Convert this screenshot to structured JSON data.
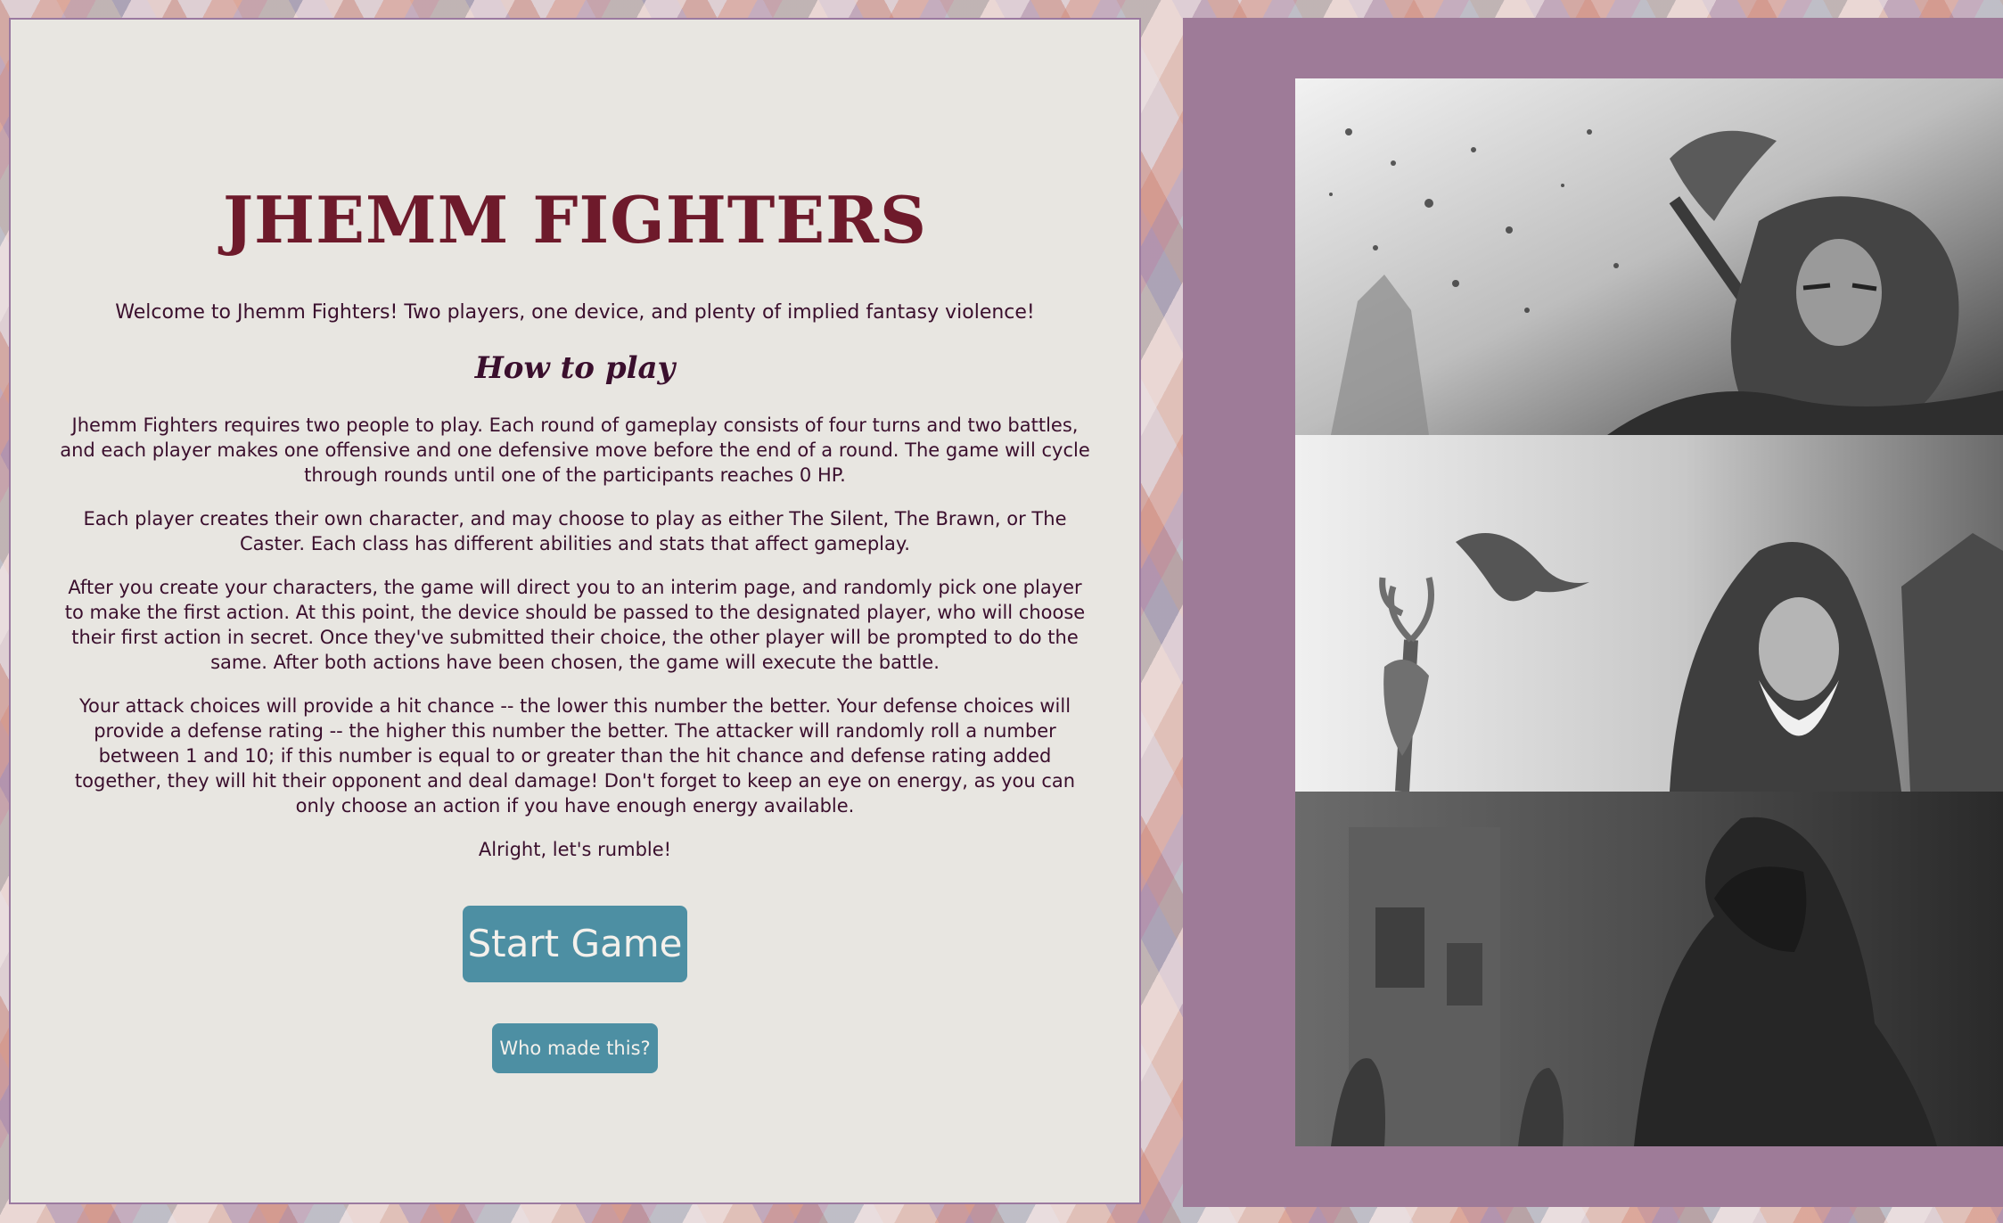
{
  "title": "JHEMM FIGHTERS",
  "intro": "Welcome to Jhemm Fighters! Two players, one device, and plenty of implied fantasy violence!",
  "how_to_play": {
    "heading": "How to play",
    "paragraphs": [
      "Jhemm Fighters requires two people to play. Each round of gameplay consists of four turns and two battles, and each player makes one offensive and one defensive move before the end of a round. The game will cycle through rounds until one of the participants reaches 0 HP.",
      "Each player creates their own character, and may choose to play as either The Silent, The Brawn, or The Caster. Each class has different abilities and stats that affect gameplay.",
      "After you create your characters, the game will direct you to an interim page, and randomly pick one player to make the first action. At this point, the device should be passed to the designated player, who will choose their first action in secret. Once they've submitted their choice, the other player will be prompted to do the same. After both actions have been chosen, the game will execute the battle.",
      "Your attack choices will provide a hit chance -- the lower this number the better. Your defense choices will provide a defense rating -- the higher this number the better. The attacker will randomly roll a number between 1 and 10; if this number is equal to or greater than the hit chance and defense rating added together, they will hit their opponent and deal damage! Don't forget to keep an eye on energy, as you can only choose an action if you have enough energy available.",
      "Alright, let's rumble!"
    ]
  },
  "buttons": {
    "start": "Start Game",
    "who": "Who made this?"
  },
  "colors": {
    "title": "#6e1a2b",
    "text": "#3a0f2d",
    "panel_bg": "#e8e6e1",
    "art_frame_bg": "#9e7b98",
    "button_bg": "#4d8fa3"
  }
}
